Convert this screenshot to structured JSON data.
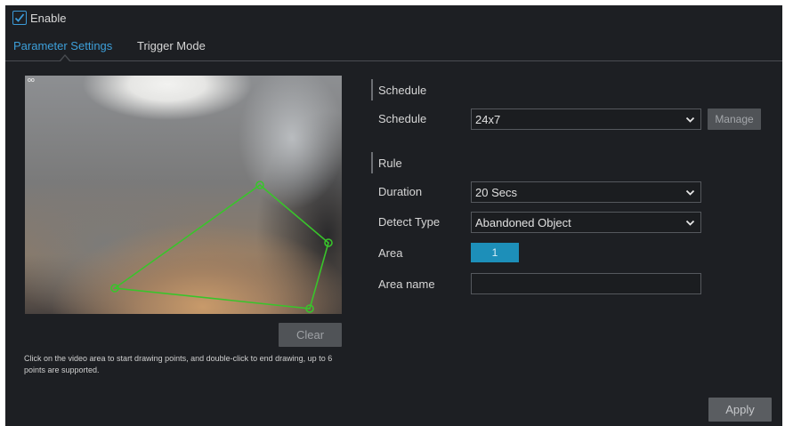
{
  "enable": {
    "label": "Enable",
    "checked": true
  },
  "tabs": [
    {
      "label": "Parameter Settings",
      "active": true
    },
    {
      "label": "Trigger Mode",
      "active": false
    }
  ],
  "video": {
    "badge": "oo"
  },
  "clear_label": "Clear",
  "hint": "Click on the video area to start drawing points, and double-click to end drawing, up to 6 points are supported.",
  "schedule_section": {
    "title": "Schedule",
    "schedule_label": "Schedule",
    "schedule_value": "24x7",
    "manage_label": "Manage"
  },
  "rule_section": {
    "title": "Rule",
    "duration_label": "Duration",
    "duration_value": "20 Secs",
    "detect_type_label": "Detect Type",
    "detect_type_value": "Abandoned Object",
    "area_label": "Area",
    "area_value": "1",
    "area_name_label": "Area name",
    "area_name_value": ""
  },
  "apply_label": "Apply",
  "colors": {
    "accent": "#3d9fd9",
    "area_button": "#1d8fb9",
    "polygon": "#39c42b",
    "background": "#1d1f23"
  }
}
